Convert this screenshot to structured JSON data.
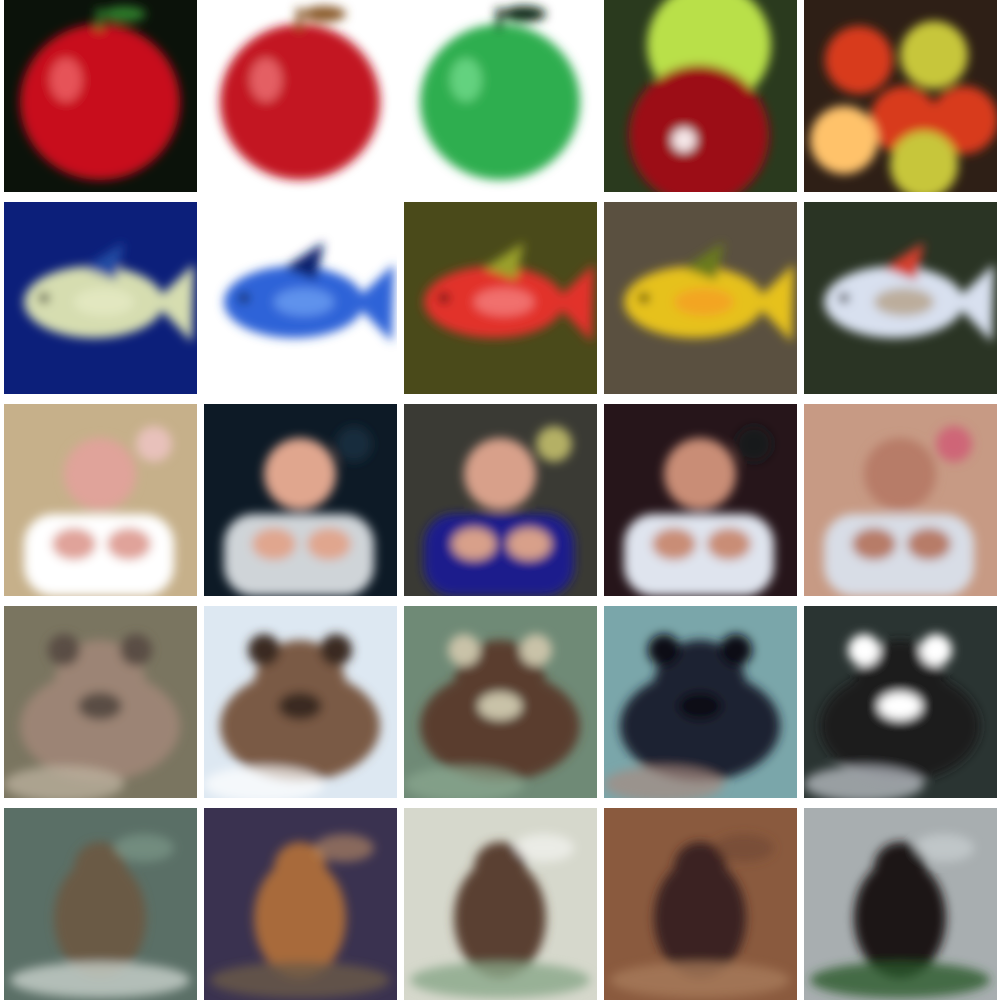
{
  "grid": {
    "rows": 5,
    "cols": 5,
    "tiles": [
      {
        "subject": "apple",
        "colors": {
          "bg": "#0b120a",
          "main": "#c8101c",
          "accent": "#2f7a2a",
          "highlight": "#ff8a8a"
        }
      },
      {
        "subject": "apple",
        "colors": {
          "bg": "#ffffff",
          "main": "#c31620",
          "accent": "#8a5a2a",
          "highlight": "#ff9a9a"
        }
      },
      {
        "subject": "apple",
        "colors": {
          "bg": "#ffffff",
          "main": "#2fae4f",
          "accent": "#0e2c14",
          "highlight": "#8ff0a8"
        }
      },
      {
        "subject": "apple",
        "colors": {
          "bg": "#2a3a1e",
          "main": "#9c0d16",
          "accent": "#b9e04a",
          "highlight": "#ffffff"
        }
      },
      {
        "subject": "apple",
        "colors": {
          "bg": "#2e1f16",
          "main": "#d83a1e",
          "accent": "#c7c63a",
          "highlight": "#ffc26b"
        }
      },
      {
        "subject": "fish",
        "colors": {
          "bg": "#0c1f7a",
          "main": "#d6ddb0",
          "accent": "#244ba3",
          "highlight": "#eef1cf"
        }
      },
      {
        "subject": "fish",
        "colors": {
          "bg": "#ffffff",
          "main": "#2d64d8",
          "accent": "#0e246e",
          "highlight": "#8fc0ff"
        }
      },
      {
        "subject": "fish",
        "colors": {
          "bg": "#4a4a1a",
          "main": "#e2312a",
          "accent": "#9aa02a",
          "highlight": "#ffb0b0"
        }
      },
      {
        "subject": "fish",
        "colors": {
          "bg": "#5a5040",
          "main": "#e6c11f",
          "accent": "#6a7a1c",
          "highlight": "#ff8a2a"
        }
      },
      {
        "subject": "fish",
        "colors": {
          "bg": "#2a3424",
          "main": "#d8e0ef",
          "accent": "#d3402e",
          "highlight": "#9f7a4a"
        }
      },
      {
        "subject": "baby",
        "colors": {
          "bg": "#c6b08a",
          "main": "#e0a39a",
          "accent": "#ffffff",
          "highlight": "#f7c9d0"
        }
      },
      {
        "subject": "baby",
        "colors": {
          "bg": "#0d1a26",
          "main": "#e0a68e",
          "accent": "#cfd4d8",
          "highlight": "#1c3246"
        }
      },
      {
        "subject": "baby",
        "colors": {
          "bg": "#3a3a34",
          "main": "#d8a08a",
          "accent": "#1c1f8c",
          "highlight": "#e8e27a"
        }
      },
      {
        "subject": "baby",
        "colors": {
          "bg": "#26151a",
          "main": "#c98d76",
          "accent": "#dfe4ee",
          "highlight": "#101820"
        }
      },
      {
        "subject": "baby",
        "colors": {
          "bg": "#c79a84",
          "main": "#b77b68",
          "accent": "#d8dde6",
          "highlight": "#d14e72"
        }
      },
      {
        "subject": "bear",
        "colors": {
          "bg": "#7a7560",
          "main": "#9c8474",
          "accent": "#5a4e44",
          "highlight": "#c2b6a4"
        }
      },
      {
        "subject": "bear",
        "colors": {
          "bg": "#dde8f2",
          "main": "#7a5a44",
          "accent": "#3a2a20",
          "highlight": "#ffffff"
        }
      },
      {
        "subject": "bear",
        "colors": {
          "bg": "#6f8a76",
          "main": "#5a3e2e",
          "accent": "#c9c2a8",
          "highlight": "#8aa890"
        }
      },
      {
        "subject": "bear",
        "colors": {
          "bg": "#7aa6aa",
          "main": "#1d2430",
          "accent": "#0c1016",
          "highlight": "#a88a80"
        }
      },
      {
        "subject": "bear",
        "colors": {
          "bg": "#2a3432",
          "main": "#1a1a1e",
          "accent": "#ffffff",
          "highlight": "#c8ccd2"
        }
      },
      {
        "subject": "otter",
        "colors": {
          "bg": "#5a6f66",
          "main": "#6a5a44",
          "accent": "#c9d2cc",
          "highlight": "#8aa896"
        }
      },
      {
        "subject": "otter",
        "colors": {
          "bg": "#3a3250",
          "main": "#a86a3a",
          "accent": "#6a5a48",
          "highlight": "#d8a06a"
        }
      },
      {
        "subject": "otter",
        "colors": {
          "bg": "#d6d8cc",
          "main": "#5a4030",
          "accent": "#8aa88a",
          "highlight": "#ffffff"
        }
      },
      {
        "subject": "otter",
        "colors": {
          "bg": "#8a5a3e",
          "main": "#3a2220",
          "accent": "#a87a5a",
          "highlight": "#6a4030"
        }
      },
      {
        "subject": "otter",
        "colors": {
          "bg": "#a8aeb0",
          "main": "#1a1612",
          "accent": "#2a5a2a",
          "highlight": "#d8dde0"
        }
      }
    ]
  }
}
